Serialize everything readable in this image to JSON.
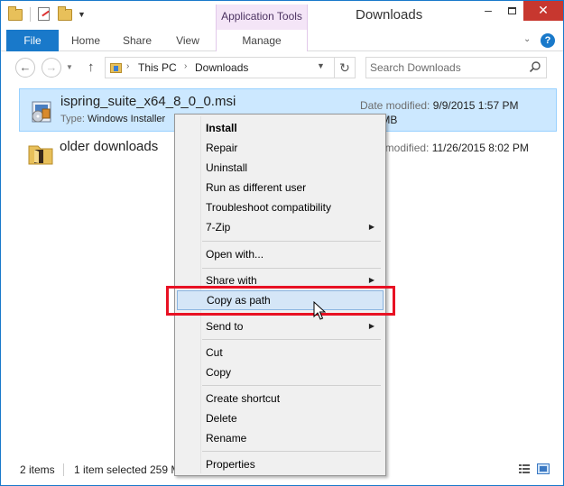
{
  "titlebar": {
    "title": "Downloads",
    "contextual_tab_group": "Application Tools"
  },
  "ribbon": {
    "tabs": [
      "File",
      "Home",
      "Share",
      "View",
      "Manage"
    ]
  },
  "address": {
    "crumbs": [
      "This PC",
      "Downloads"
    ]
  },
  "search": {
    "placeholder": "Search Downloads"
  },
  "files": [
    {
      "name": "ispring_suite_x64_8_0_0.msi",
      "type_label": "Type:",
      "type_value": "Windows Installer",
      "date_label": "Date modified:",
      "date_value": "9/9/2015 1:57 PM",
      "size_value": "259 MB",
      "selected": true
    },
    {
      "name": "older downloads",
      "date_label": "Date modified:",
      "date_value": "11/26/2015 8:02 PM",
      "selected": false
    }
  ],
  "status": {
    "items_count": "2 items",
    "selection": "1 item selected",
    "selection_size": "259 M"
  },
  "context_menu": {
    "items": [
      {
        "label": "Install",
        "bold": true
      },
      {
        "label": "Repair"
      },
      {
        "label": "Uninstall"
      },
      {
        "label": "Run as different user"
      },
      {
        "label": "Troubleshoot compatibility"
      },
      {
        "label": "7-Zip",
        "submenu": true
      },
      {
        "label": "Open with..."
      },
      {
        "label": "Share with",
        "submenu": true
      },
      {
        "label": "Copy as path",
        "highlighted": true
      },
      {
        "label": "Send to",
        "submenu": true
      },
      {
        "label": "Cut"
      },
      {
        "label": "Copy"
      },
      {
        "label": "Create shortcut"
      },
      {
        "label": "Delete"
      },
      {
        "label": "Rename"
      },
      {
        "label": "Properties"
      }
    ]
  },
  "colors": {
    "accent": "#1979ca",
    "selection_bg": "#cce8ff",
    "contextual_tab_bg": "#f4e5f7",
    "annotation_red": "#e81123",
    "close_button": "#c7372f"
  }
}
